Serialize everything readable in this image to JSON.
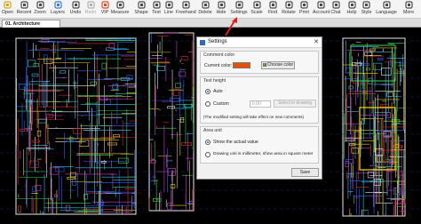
{
  "toolbar": {
    "items": [
      {
        "label": "Open",
        "icon": "open-icon",
        "disabled": false
      },
      {
        "label": "Recent",
        "icon": "recent-icon",
        "disabled": false
      },
      {
        "label": "Zoom",
        "icon": "zoom-icon",
        "disabled": false
      },
      {
        "label": "Layers",
        "icon": "layers-icon",
        "disabled": false
      },
      {
        "label": "Undo",
        "icon": "undo-icon",
        "disabled": false
      },
      {
        "label": "Redo",
        "icon": "redo-icon",
        "disabled": true
      },
      {
        "label": "VIP",
        "icon": "vip-icon",
        "disabled": false
      },
      {
        "label": "Measure",
        "icon": "measure-icon",
        "disabled": false
      },
      {
        "label": "Shape",
        "icon": "shape-icon",
        "disabled": false
      },
      {
        "label": "Text",
        "icon": "text-icon",
        "disabled": false
      },
      {
        "label": "Line",
        "icon": "line-icon",
        "disabled": false
      },
      {
        "label": "Freehand",
        "icon": "freehand-icon",
        "disabled": false
      },
      {
        "label": "Delete",
        "icon": "delete-icon",
        "disabled": false
      },
      {
        "label": "Hide",
        "icon": "hide-icon",
        "disabled": false
      },
      {
        "label": "Settings",
        "icon": "settings-icon",
        "disabled": false
      },
      {
        "label": "Scale",
        "icon": "scale-icon",
        "disabled": false
      },
      {
        "label": "Find",
        "icon": "find-icon",
        "disabled": false
      },
      {
        "label": "Rotate",
        "icon": "rotate-icon",
        "disabled": false
      },
      {
        "label": "Print",
        "icon": "print-icon",
        "disabled": false
      },
      {
        "label": "Account",
        "icon": "account-icon",
        "disabled": false
      },
      {
        "label": "Chat",
        "icon": "chat-icon",
        "disabled": false
      },
      {
        "label": "Help",
        "icon": "help-icon",
        "disabled": false
      },
      {
        "label": "Style",
        "icon": "style-icon",
        "disabled": false
      },
      {
        "label": "Language",
        "icon": "language-icon",
        "disabled": false
      },
      {
        "label": "More",
        "icon": "more-icon",
        "disabled": false
      }
    ]
  },
  "tab": {
    "label": "01. Architecture"
  },
  "dialog": {
    "title": "Settings",
    "close": "✕",
    "comment_color": {
      "section_title": "Comment color",
      "current_label": "Current color:",
      "current_color": "#e8500a",
      "choose_button": "Choose color"
    },
    "text_height": {
      "section_title": "Text height",
      "auto_label": "Auto",
      "custom_label": "Custom",
      "custom_value": "0.00",
      "select_button": "Select in drawing",
      "selected": "Auto",
      "note": "(The modified setting will take effect on new comments)"
    },
    "area_unit": {
      "section_title": "Area unit",
      "option1": "Show the actual value",
      "option2": "Drawing unit is millimeter, show area in square meter",
      "selected": "option1"
    },
    "save_button": "Save"
  },
  "colors": {
    "annotation_arrow": "#e02020",
    "dialog_bg": "#f0f0f0",
    "cad_background": "#000000"
  }
}
